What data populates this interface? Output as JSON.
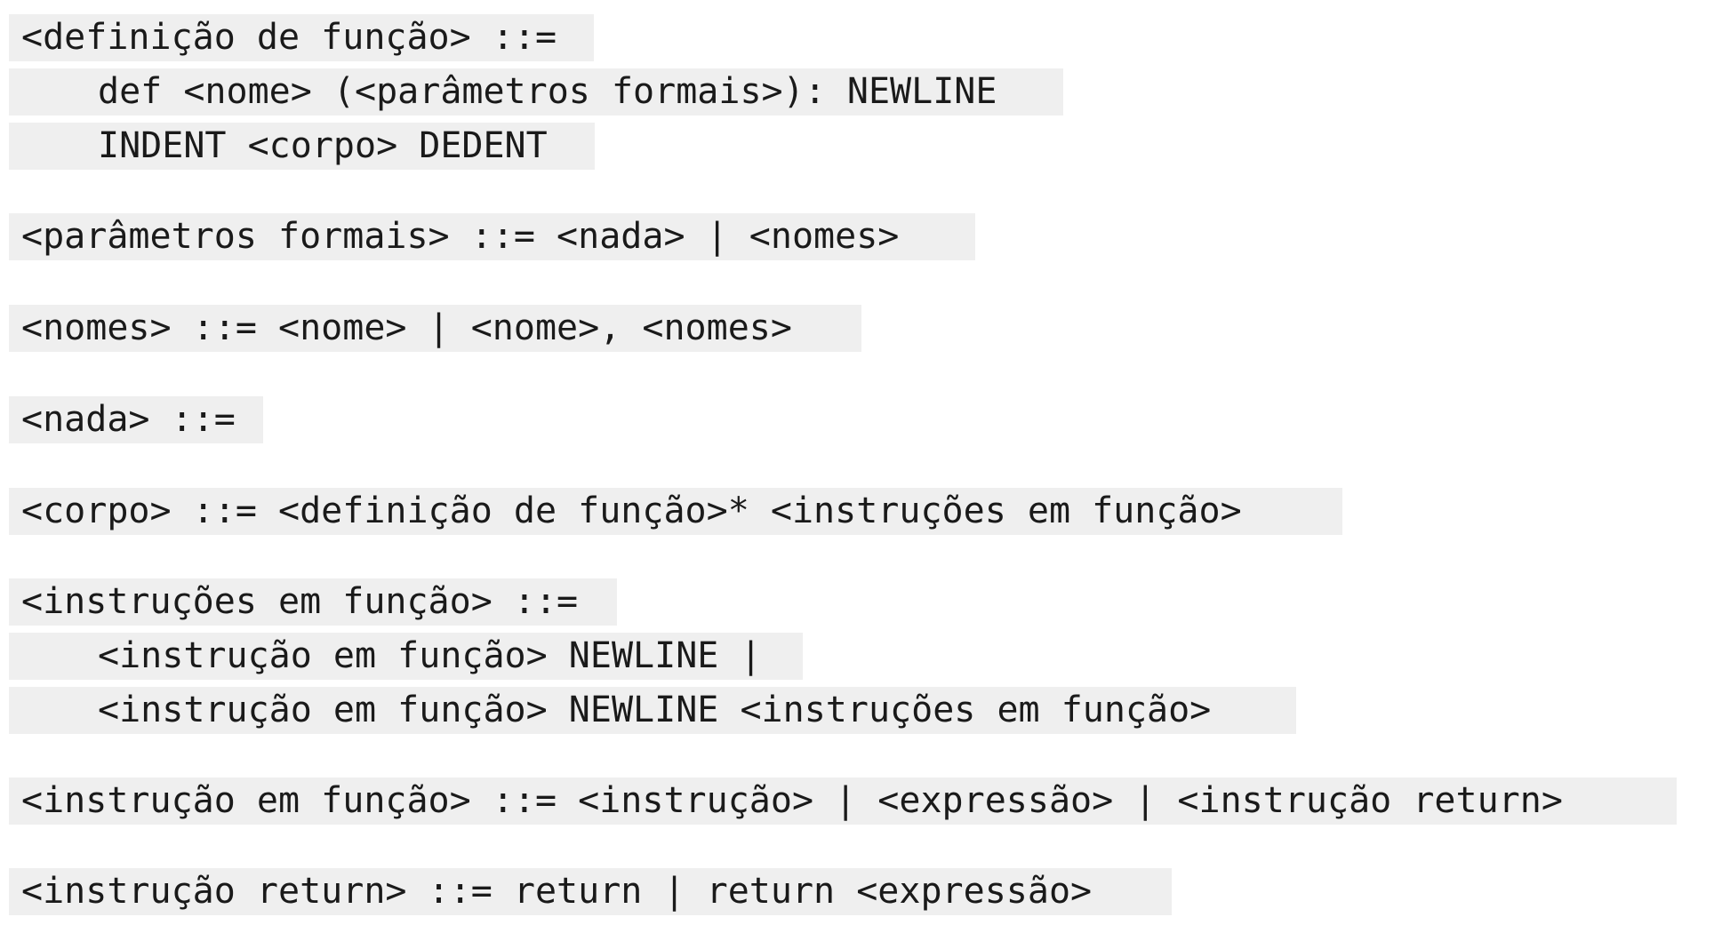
{
  "rules": [
    {
      "id": "definicao-de-funcao",
      "lines": [
        "<definição de função> ::=",
        "def <nome> (<parâmetros formais>): NEWLINE",
        "INDENT <corpo> DEDENT"
      ]
    },
    {
      "id": "parametros-formais",
      "lines": [
        "<parâmetros formais> ::= <nada> | <nomes>"
      ]
    },
    {
      "id": "nomes",
      "lines": [
        "<nomes> ::= <nome> | <nome>, <nomes>"
      ]
    },
    {
      "id": "nada",
      "lines": [
        "<nada> ::="
      ]
    },
    {
      "id": "corpo",
      "lines": [
        "<corpo> ::= <definição de função>* <instruções em função>"
      ]
    },
    {
      "id": "instrucoes-em-funcao",
      "lines": [
        "<instruções em função> ::=",
        "<instrução em função> NEWLINE |",
        "<instrução em função> NEWLINE <instruções em função>"
      ]
    },
    {
      "id": "instrucao-em-funcao",
      "lines": [
        "<instrução em função> ::= <instrução> | <expressão> | <instrução return>"
      ]
    },
    {
      "id": "instrucao-return",
      "lines": [
        "<instrução return> ::= return | return <expressão>"
      ]
    }
  ]
}
